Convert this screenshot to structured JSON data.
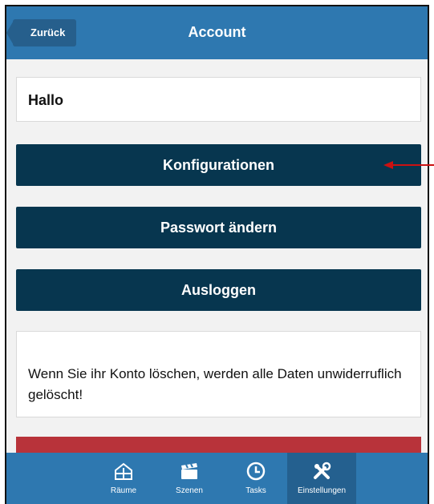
{
  "header": {
    "back_label": "Zurück",
    "title": "Account"
  },
  "greeting": "Hallo",
  "buttons": {
    "config": "Konfigurationen",
    "password": "Passwort ändern",
    "logout": "Ausloggen"
  },
  "warning_text": "Wenn Sie ihr Konto löschen, werden alle Daten unwiderruflich gelöscht!",
  "tabs": [
    {
      "label": "Räume",
      "icon": "house-icon"
    },
    {
      "label": "Szenen",
      "icon": "clapperboard-icon"
    },
    {
      "label": "Tasks",
      "icon": "clock-icon"
    },
    {
      "label": "Einstellungen",
      "icon": "wrench-screwdriver-icon"
    }
  ],
  "colors": {
    "header": "#2e78b0",
    "button": "#07364f",
    "delete": "#b8333a",
    "annotation_arrow": "#cc1111"
  }
}
